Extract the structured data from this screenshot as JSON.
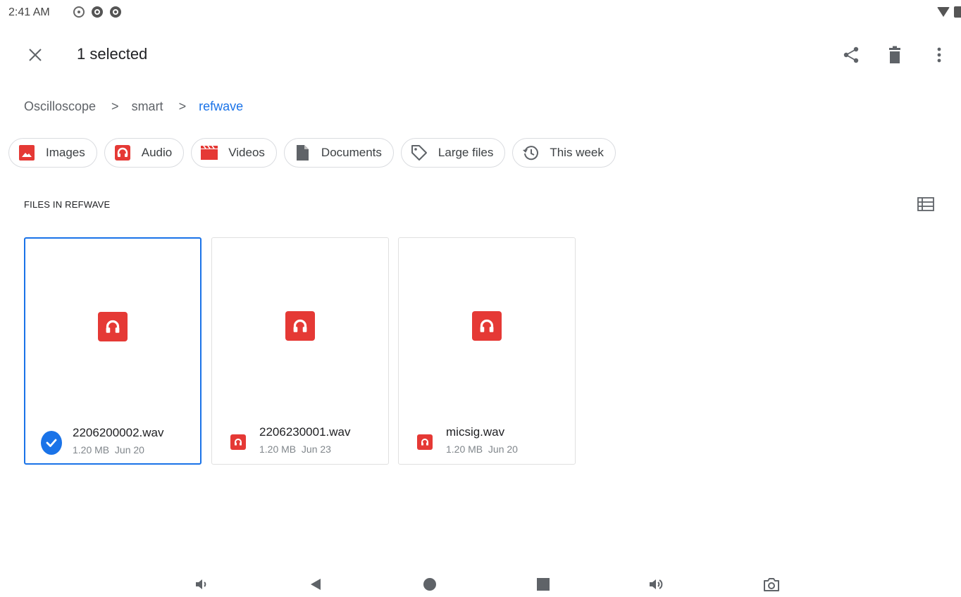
{
  "status_bar": {
    "time": "2:41 AM",
    "icons": [
      "target-icon",
      "app-icon",
      "app-icon"
    ],
    "right_icons": [
      "wifi-icon",
      "battery-icon"
    ]
  },
  "app_bar": {
    "title": "1 selected",
    "close_icon": "close-icon",
    "actions": [
      "share-icon",
      "delete-icon",
      "more-vert-icon"
    ]
  },
  "breadcrumb": {
    "items": [
      "Oscilloscope",
      "smart",
      "refwave"
    ],
    "separator": ">"
  },
  "filter_chips": [
    {
      "label": "Images",
      "icon": "image-icon"
    },
    {
      "label": "Audio",
      "icon": "headphones-icon"
    },
    {
      "label": "Videos",
      "icon": "clapperboard-icon"
    },
    {
      "label": "Documents",
      "icon": "document-icon"
    },
    {
      "label": "Large files",
      "icon": "tag-icon"
    },
    {
      "label": "This week",
      "icon": "history-icon"
    }
  ],
  "section": {
    "title": "FILES IN REFWAVE",
    "view_toggle_icon": "list-view-icon"
  },
  "files": [
    {
      "name": "2206200002.wav",
      "size": "1.20 MB",
      "date": "Jun 20",
      "sub": "1.20 MB  Jun 20",
      "selected": true
    },
    {
      "name": "2206230001.wav",
      "size": "1.20 MB",
      "date": "Jun 23",
      "sub": "1.20 MB  Jun 23",
      "selected": false
    },
    {
      "name": "micsig.wav",
      "size": "1.20 MB",
      "date": "Jun 20",
      "sub": "1.20 MB  Jun 20",
      "selected": false
    }
  ],
  "nav_bar": [
    "volume-down-icon",
    "back-icon",
    "home-icon",
    "recents-icon",
    "volume-up-icon",
    "camera-icon"
  ],
  "colors": {
    "accent": "#1a73e8",
    "audio_red": "#e53935",
    "text_primary": "#202124",
    "text_secondary": "#80868b"
  }
}
